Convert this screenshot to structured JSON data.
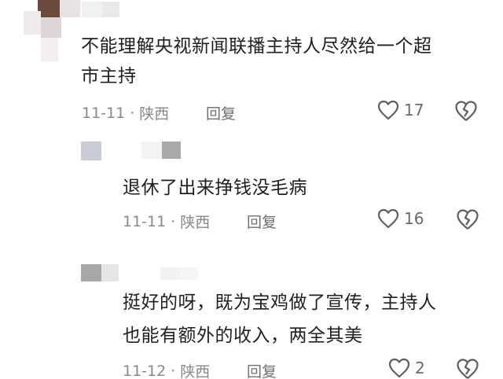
{
  "comments": [
    {
      "text_line1": "不能理解央视新闻联播主持人尽然给一个超",
      "text_line2": "市主持",
      "date": "11-11",
      "location": "陕西",
      "reply_label": "回复",
      "likes": "17"
    },
    {
      "text_line1": "退休了出来挣钱没毛病",
      "date": "11-11",
      "location": "陕西",
      "reply_label": "回复",
      "likes": "16"
    },
    {
      "text_line1": "挺好的呀，既为宝鸡做了宣传，主持人",
      "text_line2": "也能有额外的收入，两全其美",
      "date": "11-12",
      "location": "陕西",
      "reply_label": "回复",
      "likes": "2"
    }
  ],
  "meta_separator": "·",
  "icons": {
    "like": "heart-outline-icon",
    "dislike": "broken-heart-icon"
  },
  "colors": {
    "text": "#1f1f1f",
    "meta": "#8a8a8a",
    "icon": "#6a6a6a"
  }
}
